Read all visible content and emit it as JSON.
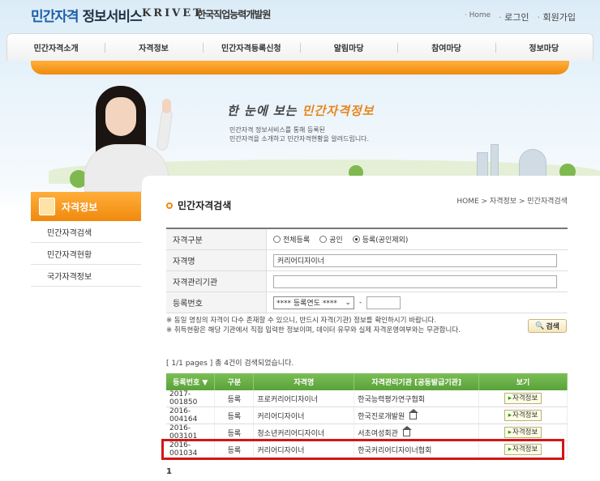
{
  "header": {
    "logo_main": "민간자격",
    "logo_sub": "정보서비스",
    "logo_krivet": "KRIVET",
    "logo_org": "한국직업능력개발원",
    "links": {
      "home": "Home",
      "login": "로그인",
      "join": "회원가입"
    }
  },
  "nav": [
    "민간자격소개",
    "자격정보",
    "민간자격등록신청",
    "알림마당",
    "참여마당",
    "정보마당"
  ],
  "banner": {
    "title_pre": "한 눈에 보는 ",
    "title_em": "민간자격정보",
    "desc1": "민간자격 정보서비스를 통해 등록된",
    "desc2": "민간자격을 소개하고 민간자격현황을 알려드립니다."
  },
  "sidebar": {
    "title": "자격정보",
    "items": [
      "민간자격검색",
      "민간자격현황",
      "국가자격정보"
    ]
  },
  "page": {
    "title": "민간자격검색",
    "breadcrumb": "HOME > 자격정보 > 민간자격검색"
  },
  "form": {
    "type_label": "자격구분",
    "type_options": [
      "전체등록",
      "공인",
      "등록(공인제외)"
    ],
    "type_selected": 2,
    "name_label": "자격명",
    "name_value": "커리어디자이너",
    "org_label": "자격관리기관",
    "org_value": "",
    "regno_label": "등록번호",
    "regno_select": "**** 등록연도 ****",
    "regno_sep": "-",
    "regno_value": "",
    "note1": "※ 동일 명칭의 자격이 다수 존재할 수 있으니, 반드시 자격(기관) 정보를 확인하시기 바랍니다.",
    "note2": "※ 취득현황은 해당 기관에서 직접 입력한 정보이며, 데이터 유무와 실제 자격운영여부와는 무관합니다.",
    "search_button": "검색"
  },
  "results": {
    "summary": "[ 1/1 pages ] 총 4건이 검색되었습니다.",
    "headers": [
      "등록번호 ▼",
      "구분",
      "자격명",
      "자격관리기관 [공동발급기관]",
      "보기"
    ],
    "view_label": "자격정보",
    "rows": [
      {
        "regno": "2017-001850",
        "type": "등록",
        "name": "프로커리어디자이너",
        "org": "한국능력평가연구협회"
      },
      {
        "regno": "2016-004164",
        "type": "등록",
        "name": "커리어디자이너",
        "org": "한국진로개발원"
      },
      {
        "regno": "2016-003101",
        "type": "등록",
        "name": "청소년커리어디자이너",
        "org": "서초여성회관"
      },
      {
        "regno": "2016-001034",
        "type": "등록",
        "name": "커리어디자이너",
        "org": "한국커리어디자이너협회"
      }
    ],
    "page": "1"
  },
  "colors": {
    "accent_orange": "#f08a0e",
    "table_green": "#5aa23a",
    "highlight_red": "#d31616",
    "logo_blue": "#1d5fa8"
  }
}
